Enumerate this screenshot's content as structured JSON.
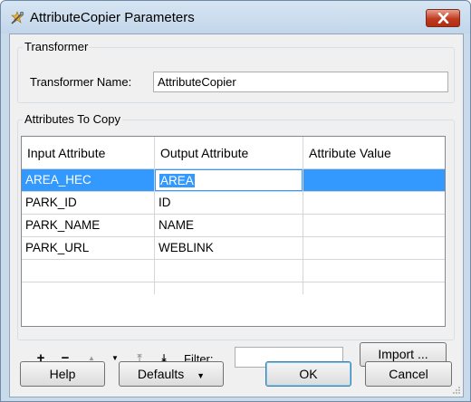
{
  "window": {
    "title": "AttributeCopier Parameters"
  },
  "transformer_group": {
    "title": "Transformer",
    "name_label": "Transformer Name:",
    "name_value": "AttributeCopier"
  },
  "attributes_group": {
    "title": "Attributes To Copy",
    "columns": [
      "Input Attribute",
      "Output Attribute",
      "Attribute Value"
    ],
    "rows": [
      [
        "AREA_HEC",
        "AREA",
        ""
      ],
      [
        "PARK_ID",
        "ID",
        ""
      ],
      [
        "PARK_NAME",
        "NAME",
        ""
      ],
      [
        "PARK_URL",
        "WEBLINK",
        ""
      ],
      [
        "",
        "",
        ""
      ]
    ],
    "selected_row": 0,
    "toolbar": {
      "add_glyph": "+",
      "remove_glyph": "−",
      "move_up_glyph": "▲",
      "move_down_glyph": "▼",
      "move_top_glyph": "⤒",
      "move_bottom_glyph": "⤓",
      "filter_label": "Filter:",
      "filter_value": "",
      "import_label": "Import ..."
    }
  },
  "footer": {
    "help_label": "Help",
    "defaults_label": "Defaults",
    "ok_label": "OK",
    "cancel_label": "Cancel"
  },
  "colors": {
    "selection": "#3399ff",
    "close_button": "#c1391f",
    "titlebar": "#c9daea"
  }
}
